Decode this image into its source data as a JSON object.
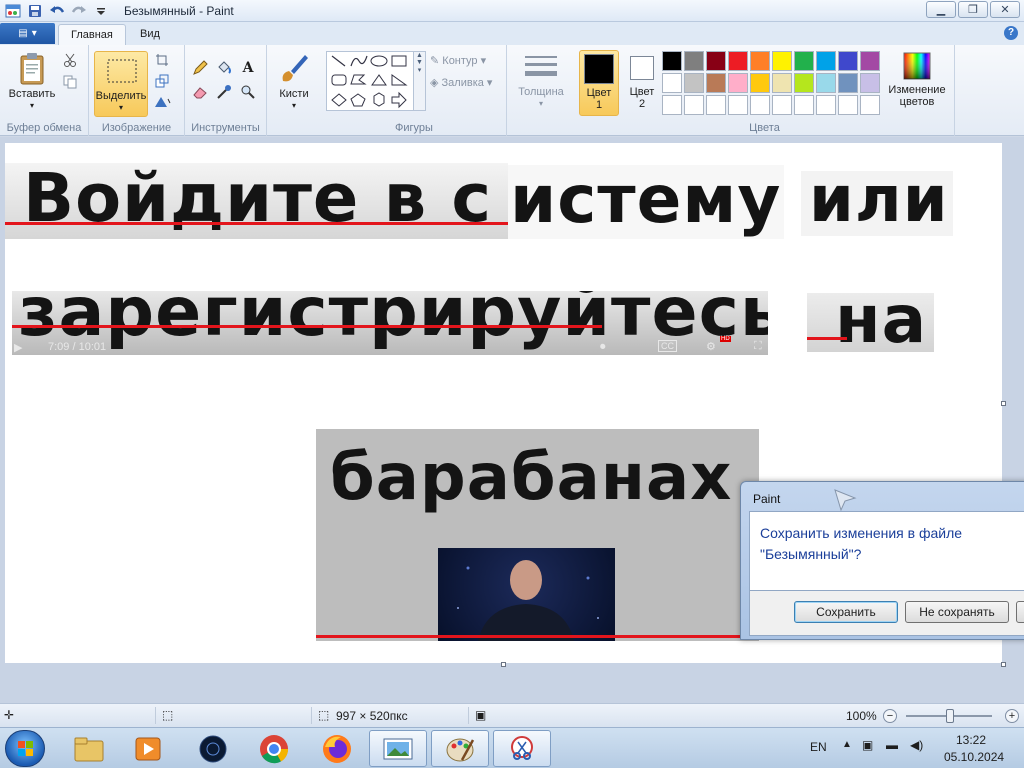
{
  "window": {
    "title": "Безымянный - Paint"
  },
  "tabs": [
    {
      "label": "Главная"
    },
    {
      "label": "Вид"
    }
  ],
  "ribbon": {
    "clipboard": {
      "paste_label": "Вставить",
      "group_label": "Буфер обмена"
    },
    "image": {
      "select_label": "Выделить",
      "group_label": "Изображение"
    },
    "tools": {
      "text_glyph": "A",
      "group_label": "Инструменты"
    },
    "brushes": {
      "label": "Кисти"
    },
    "shapes": {
      "outline_label": "Контур",
      "fill_label": "Заливка",
      "group_label": "Фигуры"
    },
    "size": {
      "label": "Толщина"
    },
    "colors": {
      "color1_label_a": "Цвет",
      "color1_label_b": "1",
      "color2_label_a": "Цвет",
      "color2_label_b": "2",
      "edit_label_a": "Изменение",
      "edit_label_b": "цветов",
      "group_label": "Цвета",
      "color1": "#000000",
      "color2": "#ffffff",
      "palette": [
        "#000000",
        "#7f7f7f",
        "#880015",
        "#ed1c24",
        "#ff7f27",
        "#fff200",
        "#22b14c",
        "#00a2e8",
        "#3f48cc",
        "#a349a4",
        "#ffffff",
        "#c3c3c3",
        "#b97a57",
        "#ffaec9",
        "#ffc90e",
        "#efe4b0",
        "#b5e61d",
        "#99d9ea",
        "#7092be",
        "#c8bfe7",
        "#ffffff",
        "#ffffff",
        "#ffffff",
        "#ffffff",
        "#ffffff",
        "#ffffff",
        "#ffffff",
        "#ffffff",
        "#ffffff",
        "#ffffff"
      ]
    }
  },
  "canvas": {
    "line1_a": "Войдите в с",
    "line1_b": "истему",
    "line1_c": "или",
    "line2_a": "зарегистрируйтесь",
    "line2_b": "на",
    "line3": "барабанах",
    "video_time": "7:09 / 10:01",
    "video_hd": "HD",
    "video_cc": "CC"
  },
  "dialog": {
    "title": "Paint",
    "message_line1": "Сохранить изменения в файле",
    "message_line2": "\"Безымянный\"?",
    "save_label": "Сохранить",
    "dont_save_label": "Не сохранять"
  },
  "statusbar": {
    "dimensions": "997 × 520пкс",
    "zoom": "100%"
  },
  "taskbar": {
    "language": "EN",
    "time": "13:22",
    "date": "05.10.2024"
  }
}
